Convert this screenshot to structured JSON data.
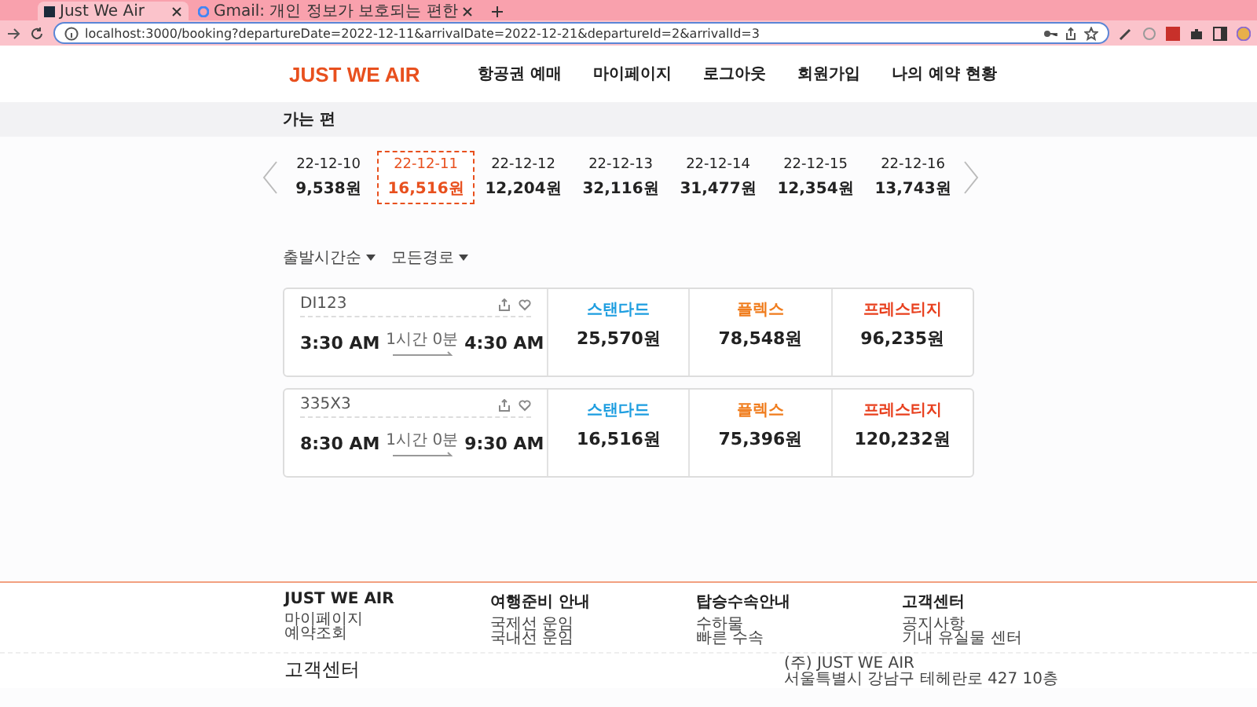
{
  "browser": {
    "tabs": [
      {
        "title": "Just We Air",
        "selected": true
      },
      {
        "title": "Gmail: 개인 정보가 보호되는 편한",
        "selected": false
      }
    ],
    "url": "localhost:3000/booking?departureDate=2022-12-11&arrivalDate=2022-12-21&departureId=2&arrivalId=3"
  },
  "header": {
    "logo": "JUST WE AIR",
    "nav": [
      {
        "label": "항공권 예매"
      },
      {
        "label": "마이페이지"
      },
      {
        "label": "로그아웃"
      },
      {
        "label": "회원가입"
      },
      {
        "label": "나의 예약 현황"
      }
    ]
  },
  "section_title": "가는 편",
  "dates": [
    {
      "date": "22-12-10",
      "price": "9,538원",
      "selected": false
    },
    {
      "date": "22-12-11",
      "price": "16,516원",
      "selected": true
    },
    {
      "date": "22-12-12",
      "price": "12,204원",
      "selected": false
    },
    {
      "date": "22-12-13",
      "price": "32,116원",
      "selected": false
    },
    {
      "date": "22-12-14",
      "price": "31,477원",
      "selected": false
    },
    {
      "date": "22-12-15",
      "price": "12,354원",
      "selected": false
    },
    {
      "date": "22-12-16",
      "price": "13,743원",
      "selected": false
    }
  ],
  "filters": [
    {
      "label": "출발시간순"
    },
    {
      "label": "모든경로"
    }
  ],
  "flights": [
    {
      "code": "DI123",
      "depart": "3:30 AM",
      "arrive": "4:30 AM",
      "duration": "1시간 0분",
      "fares": [
        {
          "class": "스탠다드",
          "price": "25,570원",
          "color": "#1e9ee0"
        },
        {
          "class": "플렉스",
          "price": "78,548원",
          "color": "#f07d1e"
        },
        {
          "class": "프레스티지",
          "price": "96,235원",
          "color": "#e8401e"
        }
      ]
    },
    {
      "code": "335X3",
      "depart": "8:30 AM",
      "arrive": "9:30 AM",
      "duration": "1시간 0분",
      "fares": [
        {
          "class": "스탠다드",
          "price": "16,516원",
          "color": "#1e9ee0"
        },
        {
          "class": "플렉스",
          "price": "75,396원",
          "color": "#f07d1e"
        },
        {
          "class": "프레스티지",
          "price": "120,232원",
          "color": "#e8401e"
        }
      ]
    }
  ],
  "footer": {
    "columns": [
      {
        "title": "JUST WE AIR",
        "links": [
          "마이페이지",
          "예약조회"
        ]
      },
      {
        "title": "여행준비 안내",
        "links": [
          "국제선 운임",
          "국내선 운임"
        ]
      },
      {
        "title": "탑승수속안내",
        "links": [
          "수하물",
          "빠른 수속"
        ]
      },
      {
        "title": "고객센터",
        "links": [
          "공지사항",
          "기내 유실물 센터"
        ]
      }
    ],
    "customer_center": "고객센터",
    "company": "(주) JUST WE AIR",
    "address": "서울특별시 강남구 테헤란로 427 10층"
  }
}
